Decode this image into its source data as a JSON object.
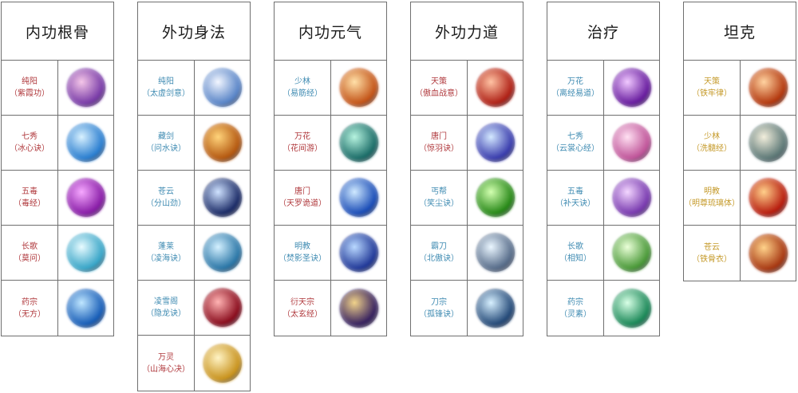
{
  "colors": {
    "red": "#b0393d",
    "blue": "#3f8bb2",
    "gold": "#c59a2a"
  },
  "columns": [
    {
      "title": "内功根骨",
      "items": [
        {
          "school": "纯阳",
          "method": "（紫霞功）",
          "color": "#b0393d",
          "icon": "meditating-figure-icon",
          "c1": "#f4c6e8",
          "c2": "#7a3da8"
        },
        {
          "school": "七秀",
          "method": "（冰心诀）",
          "color": "#b0393d",
          "icon": "ice-heart-icon",
          "c1": "#d8f1ff",
          "c2": "#2c7fd0"
        },
        {
          "school": "五毒",
          "method": "（毒经）",
          "color": "#b0393d",
          "icon": "purple-vortex-icon",
          "c1": "#f6a8ff",
          "c2": "#8a1fa8"
        },
        {
          "school": "长歌",
          "method": "（莫问）",
          "color": "#b0393d",
          "icon": "ice-crystal-icon",
          "c1": "#e8fbff",
          "c2": "#3aa6c8"
        },
        {
          "school": "药宗",
          "method": "（无方）",
          "color": "#b0393d",
          "icon": "blue-blossom-icon",
          "c1": "#bfe6ff",
          "c2": "#1a5fb8"
        }
      ]
    },
    {
      "title": "外功身法",
      "items": [
        {
          "school": "纯阳",
          "method": "（太虚剑意）",
          "color": "#3f8bb2",
          "icon": "yin-yang-icon",
          "c1": "#f2f6ff",
          "c2": "#5b86c8"
        },
        {
          "school": "藏剑",
          "method": "（问水诀）",
          "color": "#3f8bb2",
          "icon": "golden-swords-icon",
          "c1": "#ffd37a",
          "c2": "#b55a12"
        },
        {
          "school": "苍云",
          "method": "（分山劲）",
          "color": "#3f8bb2",
          "icon": "dark-wave-icon",
          "c1": "#cfe2ff",
          "c2": "#1f2f6a"
        },
        {
          "school": "蓬莱",
          "method": "（凌海诀）",
          "color": "#3f8bb2",
          "icon": "sea-swirl-icon",
          "c1": "#d3f0ff",
          "c2": "#2d78a8"
        },
        {
          "school": "凌雪阁",
          "method": "（隐龙诀）",
          "color": "#3f8bb2",
          "icon": "crimson-blade-icon",
          "c1": "#ffb3b3",
          "c2": "#8c1020"
        },
        {
          "school": "万灵",
          "method": "（山海心决）",
          "color": "#b0393d",
          "icon": "golden-feather-icon",
          "c1": "#fff3c4",
          "c2": "#c99420"
        }
      ]
    },
    {
      "title": "内功元气",
      "items": [
        {
          "school": "少林",
          "method": "（易筋经）",
          "color": "#3f8bb2",
          "icon": "flame-monk-icon",
          "c1": "#ffe0a8",
          "c2": "#c4561a"
        },
        {
          "school": "万花",
          "method": "（花间游）",
          "color": "#b0393d",
          "icon": "teal-figure-icon",
          "c1": "#b6f3df",
          "c2": "#1e6f6a"
        },
        {
          "school": "唐门",
          "method": "（天罗诡道）",
          "color": "#b0393d",
          "icon": "blue-flames-icon",
          "c1": "#cfe9ff",
          "c2": "#1d4fb8"
        },
        {
          "school": "明教",
          "method": "（焚影圣诀）",
          "color": "#3f8bb2",
          "icon": "blue-shadow-icon",
          "c1": "#b9d8ff",
          "c2": "#243c9a"
        },
        {
          "school": "衍天宗",
          "method": "（太玄经）",
          "color": "#b0393d",
          "icon": "dark-orb-icon",
          "c1": "#f0d28a",
          "c2": "#3a2460"
        }
      ]
    },
    {
      "title": "外功力道",
      "items": [
        {
          "school": "天策",
          "method": "（傲血战意）",
          "color": "#b0393d",
          "icon": "red-warrior-icon",
          "c1": "#ffc2a3",
          "c2": "#b02318"
        },
        {
          "school": "唐门",
          "method": "（惊羽诀）",
          "color": "#b0393d",
          "icon": "blue-arrow-icon",
          "c1": "#d3e8ff",
          "c2": "#3c3fae"
        },
        {
          "school": "丐帮",
          "method": "（笑尘诀）",
          "color": "#3f8bb2",
          "icon": "kicking-fighter-icon",
          "c1": "#d2ffb0",
          "c2": "#2a8a1a"
        },
        {
          "school": "霸刀",
          "method": "（北傲诀）",
          "color": "#3f8bb2",
          "icon": "broadsword-icon",
          "c1": "#eaf6ff",
          "c2": "#5a6f8c"
        },
        {
          "school": "刀宗",
          "method": "（孤锋诀）",
          "color": "#3f8bb2",
          "icon": "blade-fighter-icon",
          "c1": "#d7f0ff",
          "c2": "#274c7a"
        }
      ]
    },
    {
      "title": "治疗",
      "items": [
        {
          "school": "万花",
          "method": "（离经易道）",
          "color": "#3f8bb2",
          "icon": "purple-figure-icon",
          "c1": "#f0c8ff",
          "c2": "#6a1fa0"
        },
        {
          "school": "七秀",
          "method": "（云裳心经）",
          "color": "#3f8bb2",
          "icon": "pink-lotus-icon",
          "c1": "#ffe0f2",
          "c2": "#c0569a"
        },
        {
          "school": "五毒",
          "method": "（补天诀）",
          "color": "#3f8bb2",
          "icon": "purple-spire-icon",
          "c1": "#f3d6ff",
          "c2": "#7a3cb0"
        },
        {
          "school": "长歌",
          "method": "（相知）",
          "color": "#3f8bb2",
          "icon": "green-flower-icon",
          "c1": "#eaffd8",
          "c2": "#4c9a3a"
        },
        {
          "school": "药宗",
          "method": "（灵素）",
          "color": "#3f8bb2",
          "icon": "green-leaf-icon",
          "c1": "#d8ffe6",
          "c2": "#1e8a5a"
        }
      ]
    },
    {
      "title": "坦克",
      "items": [
        {
          "school": "天策",
          "method": "（铁牢律）",
          "color": "#c59a2a",
          "icon": "fire-dragon-icon",
          "c1": "#ffd2a0",
          "c2": "#b43a10"
        },
        {
          "school": "少林",
          "method": "（洗髓经）",
          "color": "#c59a2a",
          "icon": "scroll-icon",
          "c1": "#f2eedc",
          "c2": "#5f7a78"
        },
        {
          "school": "明教",
          "method": "（明尊琉璃体）",
          "color": "#c59a2a",
          "icon": "fiery-figure-icon",
          "c1": "#ffcf8a",
          "c2": "#b81f10"
        },
        {
          "school": "苍云",
          "method": "（铁骨衣）",
          "color": "#c59a2a",
          "icon": "shield-icon",
          "c1": "#ffd28a",
          "c2": "#a83a14"
        }
      ]
    }
  ]
}
